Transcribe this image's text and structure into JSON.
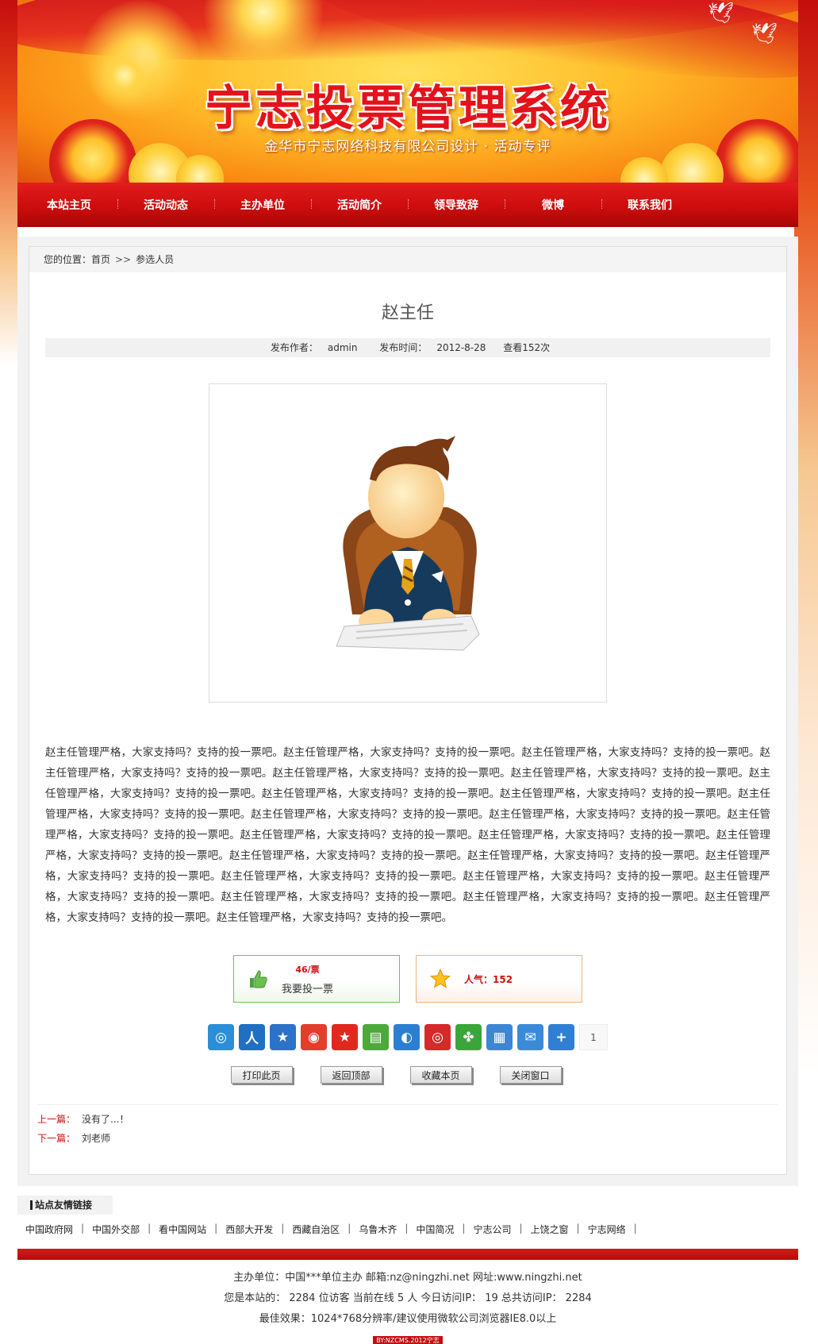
{
  "header": {
    "title": "宁志投票管理系统",
    "subtitle": "金华市宁志网络科技有限公司设计 · 活动专评"
  },
  "nav": [
    "本站主页",
    "活动动态",
    "主办单位",
    "活动简介",
    "领导致辞",
    "微博",
    "联系我们"
  ],
  "breadcrumb": {
    "prefix": "您的位置：",
    "home": "首页",
    "separator": ">>",
    "current": "参选人员"
  },
  "article": {
    "title": "赵主任",
    "author_label": "发布作者：",
    "author": "admin",
    "time_label": "发布时间：",
    "time": "2012-8-28",
    "views": "查看152次",
    "body": "赵主任管理严格，大家支持吗？支持的投一票吧。赵主任管理严格，大家支持吗？支持的投一票吧。赵主任管理严格，大家支持吗？支持的投一票吧。赵主任管理严格，大家支持吗？支持的投一票吧。赵主任管理严格，大家支持吗？支持的投一票吧。赵主任管理严格，大家支持吗？支持的投一票吧。赵主任管理严格，大家支持吗？支持的投一票吧。赵主任管理严格，大家支持吗？支持的投一票吧。赵主任管理严格，大家支持吗？支持的投一票吧。赵主任管理严格，大家支持吗？支持的投一票吧。赵主任管理严格，大家支持吗？支持的投一票吧。赵主任管理严格，大家支持吗？支持的投一票吧。赵主任管理严格，大家支持吗？支持的投一票吧。赵主任管理严格，大家支持吗？支持的投一票吧。赵主任管理严格，大家支持吗？支持的投一票吧。赵主任管理严格，大家支持吗？支持的投一票吧。赵主任管理严格，大家支持吗？支持的投一票吧。赵主任管理严格，大家支持吗？支持的投一票吧。赵主任管理严格，大家支持吗？支持的投一票吧。赵主任管理严格，大家支持吗？支持的投一票吧。赵主任管理严格，大家支持吗？支持的投一票吧。赵主任管理严格，大家支持吗？支持的投一票吧。赵主任管理严格，大家支持吗？支持的投一票吧。赵主任管理严格，大家支持吗？支持的投一票吧。赵主任管理严格，大家支持吗？支持的投一票吧。赵主任管理严格，大家支持吗？支持的投一票吧。"
  },
  "vote": {
    "count": "46/票",
    "button_label": "我要投一票",
    "popularity": "人气：152"
  },
  "share": {
    "icons": [
      {
        "name": "qzone-icon",
        "glyph": "◎",
        "color": "#2a8fd8"
      },
      {
        "name": "renren-icon",
        "glyph": "人",
        "color": "#1f6fc2"
      },
      {
        "name": "favorite-icon",
        "glyph": "★",
        "color": "#2b72c8"
      },
      {
        "name": "sina-weibo-icon",
        "glyph": "◉",
        "color": "#e33d2c"
      },
      {
        "name": "qq-star-icon",
        "glyph": "★",
        "color": "#e0281e"
      },
      {
        "name": "bookmark-icon",
        "glyph": "▤",
        "color": "#4ca93a"
      },
      {
        "name": "tencent-icon",
        "glyph": "◐",
        "color": "#2a7fd0"
      },
      {
        "name": "netease-icon",
        "glyph": "◎",
        "color": "#d42a2a"
      },
      {
        "name": "kaixin-icon",
        "glyph": "✤",
        "color": "#3aa63a"
      },
      {
        "name": "print-icon",
        "glyph": "▦",
        "color": "#3d86d4"
      },
      {
        "name": "email-icon",
        "glyph": "✉",
        "color": "#3b8ad8"
      },
      {
        "name": "more-icon",
        "glyph": "+",
        "color": "#2f7fd4"
      }
    ],
    "count": "1"
  },
  "buttons": [
    "打印此页",
    "返回顶部",
    "收藏本页",
    "关闭窗口"
  ],
  "prevnext": {
    "prev_label": "上一篇：",
    "prev": "没有了...！",
    "next_label": "下一篇：",
    "next": "刘老师"
  },
  "friends": {
    "title": "站点友情链接",
    "links": [
      "中国政府网",
      "中国外交部",
      "看中国网站",
      "西部大开发",
      "西藏自治区",
      "乌鲁木齐",
      "中国简况",
      "宁志公司",
      "上饶之窗",
      "宁志网络"
    ]
  },
  "footer": {
    "line1": "主办单位：中国***单位主办 邮箱:nz@ningzhi.net 网址:www.ningzhi.net",
    "line2": "您是本站的： 2284 位访客  当前在线 5 人 今日访问IP： 19  总共访问IP： 2284",
    "line3": "最佳效果：1024*768分辨率/建议使用微软公司浏览器IE8.0以上",
    "badge": "BY:NZCMS.2012宁志"
  }
}
